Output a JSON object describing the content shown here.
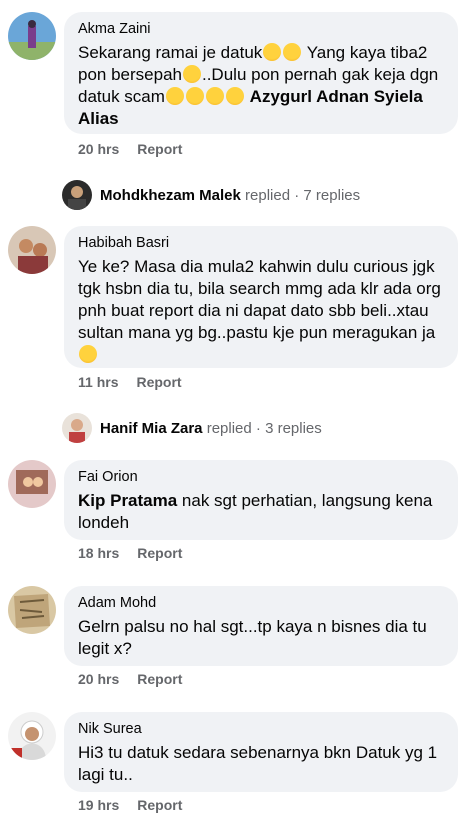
{
  "comments": [
    {
      "author": "Akma Zaini",
      "text_before": "Sekarang ramai je datuk",
      "text_mid1": " Yang kaya tiba2 pon bersepah",
      "text_mid2": "..Dulu pon pernah gak keja dgn datuk scam",
      "tag": "Azygurl Adnan Syiela Alias",
      "time": "20 hrs",
      "action": "Report"
    },
    {
      "author": "Habibah Basri",
      "text": "Ye ke? Masa dia mula2 kahwin dulu curious jgk tgk hsbn dia tu, bila search mmg ada klr ada org pnh buat report dia ni dapat dato sbb beli..xtau sultan mana yg bg..pastu kje pun meragukan ja",
      "time": "11 hrs",
      "action": "Report"
    },
    {
      "author": "Fai Orion",
      "tag": "Kip Pratama",
      "text": " nak sgt perhatian, langsung kena londeh",
      "time": "18 hrs",
      "action": "Report"
    },
    {
      "author": "Adam Mohd",
      "text": "Gelrn palsu no hal sgt...tp kaya n bisnes dia tu legit x?",
      "time": "20 hrs",
      "action": "Report"
    },
    {
      "author": "Nik Surea",
      "text": "Hi3 tu datuk sedara sebenarnya bkn Datuk yg 1 lagi tu..",
      "time": "19 hrs",
      "action": "Report"
    }
  ],
  "replies": [
    {
      "name": "Mohdkhezam Malek",
      "verb": "replied",
      "sep": "·",
      "count": "7 replies"
    },
    {
      "name": "Hanif Mia Zara",
      "verb": "replied",
      "sep": "·",
      "count": "3 replies"
    }
  ],
  "colors": {
    "bubble": "#f0f2f5",
    "meta": "#65676b",
    "text": "#050505"
  }
}
